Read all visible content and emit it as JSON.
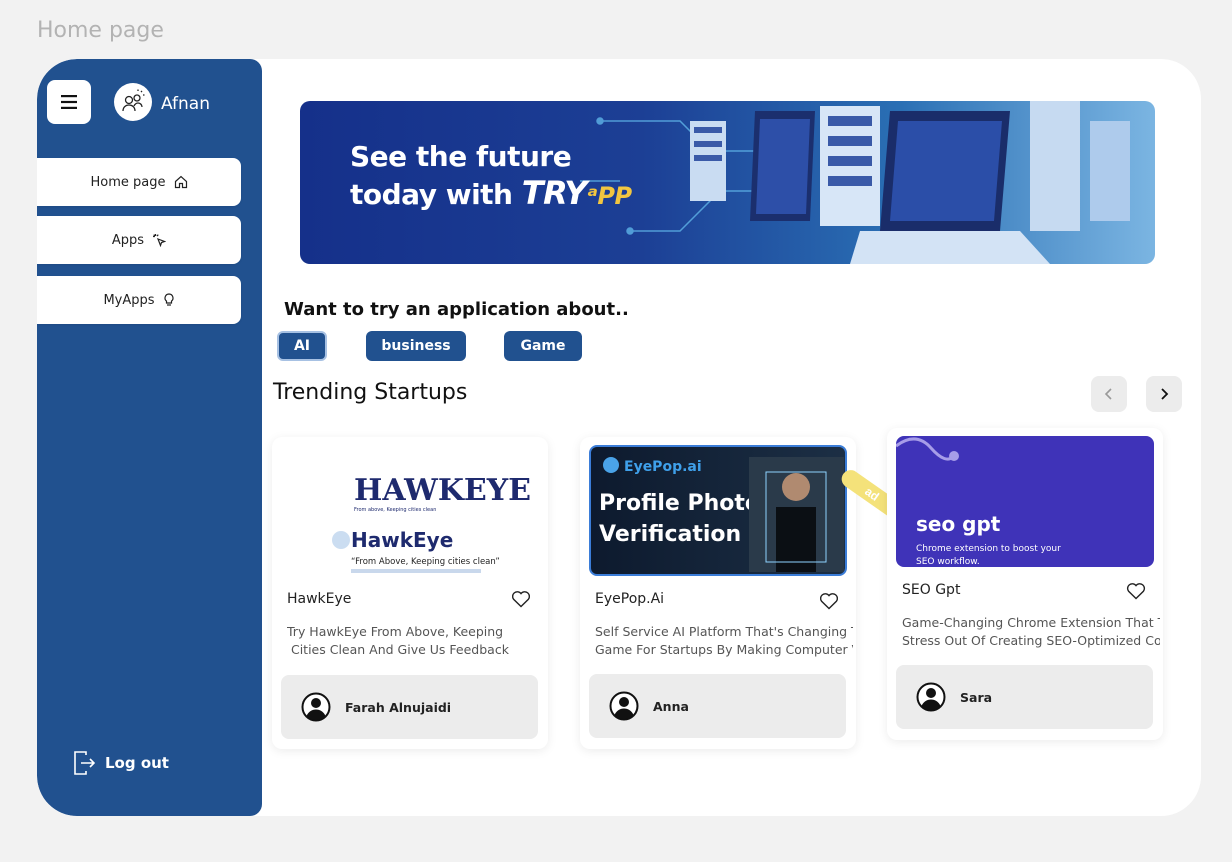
{
  "frame_label": "Home page",
  "user": {
    "name": "Afnan"
  },
  "nav": [
    {
      "label": "Home page",
      "icon": "home-icon"
    },
    {
      "label": "Apps",
      "icon": "cursor-click-icon"
    },
    {
      "label": "MyApps",
      "icon": "lightbulb-icon"
    }
  ],
  "logout_label": "Log out",
  "banner": {
    "line1": "See the future",
    "line2": "today with",
    "brand_main": "TRY",
    "brand_accent": "ᵃPP"
  },
  "question": "Want to try an application about..",
  "categories": [
    "AI",
    "business",
    "Game"
  ],
  "trending_title": "Trending Startups",
  "ad_label": "ad",
  "cards": [
    {
      "name": "HawkEye",
      "logo_text": "HAWKEYE",
      "logo_sub": "From above, Keeping cities clean",
      "brand": "HawkEye",
      "brand_tagline": "“From Above, Keeping cities clean”",
      "description": "Try HawkEye From Above, Keeping\n Cities Clean And Give Us Feedback",
      "author": "Farah Alnujaidi"
    },
    {
      "name": "EyePop.Ai",
      "logo_text": "EyePop.ai",
      "headline": "Profile Photo\nVerification",
      "description": "Self Service AI Platform That's Changing The\nGame For Startups By Making Computer Visi",
      "author": "Anna"
    },
    {
      "name": "SEO Gpt",
      "logo_text": "seo gpt",
      "logo_sub": "Chrome extension to boost your\nSEO workflow.",
      "description": "Game-Changing Chrome Extension That Take\nStress Out Of Creating SEO-Optimized Conte",
      "author": "Sara"
    }
  ],
  "colors": {
    "sidebar": "#21518f",
    "accent_yellow": "#f4e27a",
    "seo_purple": "#3f33b8"
  }
}
